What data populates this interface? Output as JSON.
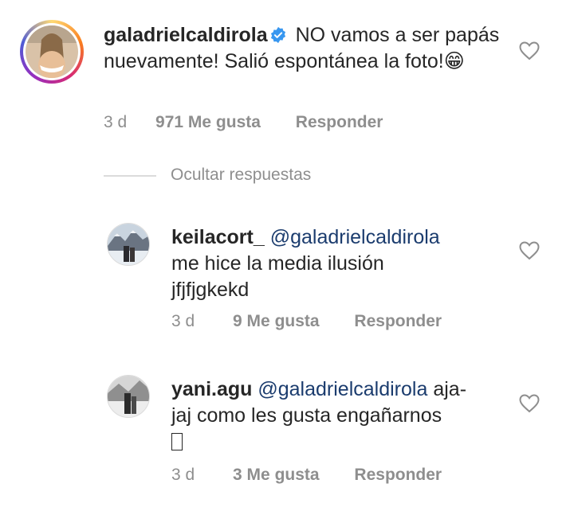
{
  "comments": [
    {
      "username": "galadrielcaldirola",
      "verified": true,
      "text": "NO vamos a ser papás nuevamente! Salió espontánea la foto!",
      "emoji": "😁",
      "time": "3 d",
      "likes": "971 Me gusta",
      "reply": "Responder"
    }
  ],
  "hide_replies_label": "Ocultar respuestas",
  "replies": [
    {
      "username": "keilacort_",
      "mention": "@galadrielcaldirola",
      "text_line1": "me hice la media ilusión",
      "text_line2": "jfjfjgkekd",
      "time": "3 d",
      "likes": "9 Me gusta",
      "reply": "Responder"
    },
    {
      "username": "yani.agu",
      "mention": "@galadrielcaldirola",
      "text_tail": "aja-",
      "text_line2": "jaj como les gusta engañarnos",
      "time": "3 d",
      "likes": "3 Me gusta",
      "reply": "Responder"
    }
  ],
  "colors": {
    "text": "#262626",
    "muted": "#8e8e8e",
    "mention": "#1b3c6e",
    "verified": "#3897f0"
  }
}
